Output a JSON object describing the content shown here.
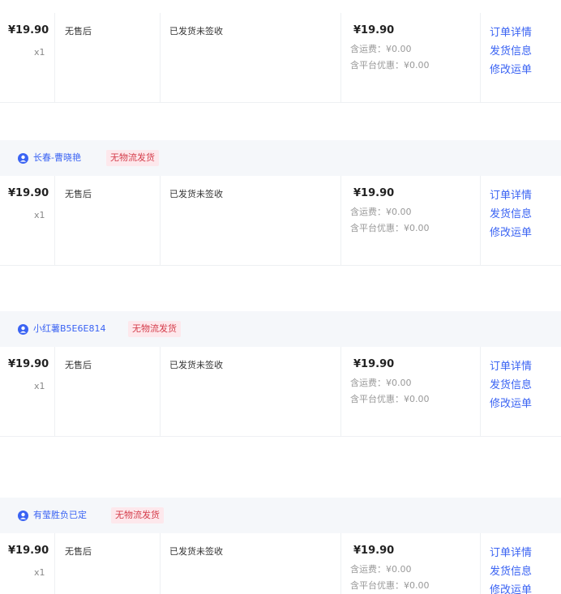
{
  "currency": "¥",
  "orders": [
    {
      "buyer": "",
      "tag": "",
      "price": "¥19.90",
      "qty": "x1",
      "after_sale": "无售后",
      "ship_status": "已发货未签收",
      "amount": "¥19.90",
      "shipping_fee": "含运费：¥0.00",
      "platform_discount": "含平台优惠：¥0.00",
      "actions": [
        "订单详情",
        "发货信息",
        "修改运单"
      ]
    },
    {
      "buyer": "长春-曹晓艳",
      "tag": "无物流发货",
      "price": "¥19.90",
      "qty": "x1",
      "after_sale": "无售后",
      "ship_status": "已发货未签收",
      "amount": "¥19.90",
      "shipping_fee": "含运费：¥0.00",
      "platform_discount": "含平台优惠：¥0.00",
      "actions": [
        "订单详情",
        "发货信息",
        "修改运单"
      ]
    },
    {
      "buyer": "小红薯B5E6E814",
      "tag": "无物流发货",
      "price": "¥19.90",
      "qty": "x1",
      "after_sale": "无售后",
      "ship_status": "已发货未签收",
      "amount": "¥19.90",
      "shipping_fee": "含运费：¥0.00",
      "platform_discount": "含平台优惠：¥0.00",
      "actions": [
        "订单详情",
        "发货信息",
        "修改运单"
      ]
    },
    {
      "buyer": "有莹胜负已定",
      "tag": "无物流发货",
      "price": "¥19.90",
      "qty": "x1",
      "after_sale": "无售后",
      "ship_status": "已发货未签收",
      "amount": "¥19.90",
      "shipping_fee": "含运费：¥0.00",
      "platform_discount": "含平台优惠：¥0.00",
      "actions": [
        "订单详情",
        "发货信息",
        "修改运单"
      ]
    }
  ],
  "colors": {
    "link": "#3a63f3",
    "tag_text": "#d43c4a",
    "tag_bg": "#fde8ec",
    "header_bg": "#f5f7fa"
  }
}
